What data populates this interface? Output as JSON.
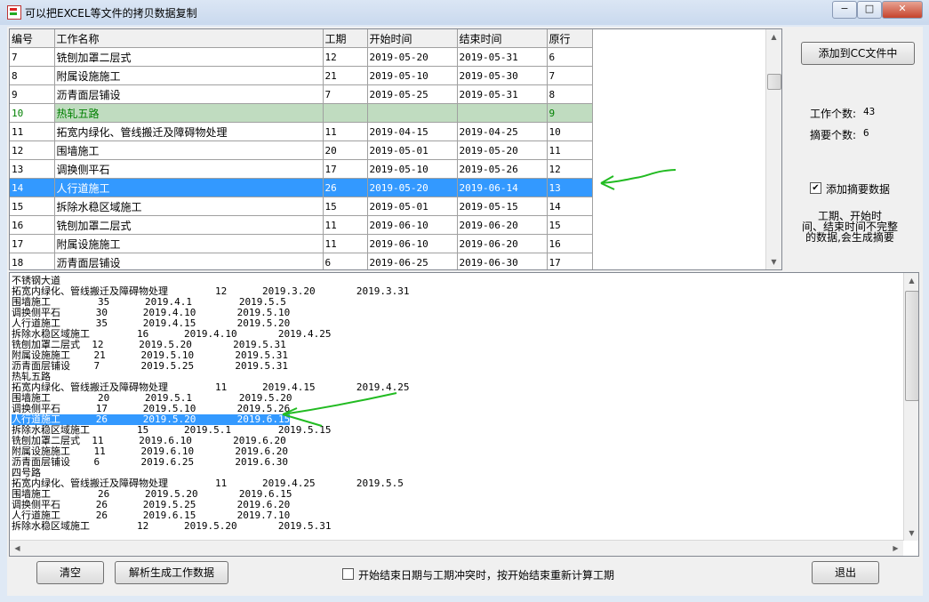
{
  "window": {
    "title": "可以把EXCEL等文件的拷贝数据复制",
    "minimize": "−",
    "maximize": "□",
    "close": "✕"
  },
  "grid": {
    "columns": [
      "编号",
      "工作名称",
      "工期",
      "开始时间",
      "结束时间",
      "原行"
    ],
    "rows": [
      [
        "7",
        "铣刨加罩二层式",
        "12",
        "2019-05-20",
        "2019-05-31",
        "6"
      ],
      [
        "8",
        "附属设施施工",
        "21",
        "2019-05-10",
        "2019-05-30",
        "7"
      ],
      [
        "9",
        "沥青面层铺设",
        "7",
        "2019-05-25",
        "2019-05-31",
        "8"
      ],
      [
        "10",
        "热轧五路",
        "",
        "",
        "",
        "9"
      ],
      [
        "11",
        "拓宽内绿化、管线搬迁及障碍物处理",
        "11",
        "2019-04-15",
        "2019-04-25",
        "10"
      ],
      [
        "12",
        "围墙施工",
        "20",
        "2019-05-01",
        "2019-05-20",
        "11"
      ],
      [
        "13",
        "调换侧平石",
        "17",
        "2019-05-10",
        "2019-05-26",
        "12"
      ],
      [
        "14",
        "人行道施工",
        "26",
        "2019-05-20",
        "2019-06-14",
        "13"
      ],
      [
        "15",
        "拆除水稳区域施工",
        "15",
        "2019-05-01",
        "2019-05-15",
        "14"
      ],
      [
        "16",
        "铣刨加罩二层式",
        "11",
        "2019-06-10",
        "2019-06-20",
        "15"
      ],
      [
        "17",
        "附属设施施工",
        "11",
        "2019-06-10",
        "2019-06-20",
        "16"
      ],
      [
        "18",
        "沥青面层铺设",
        "6",
        "2019-06-25",
        "2019-06-30",
        "17"
      ]
    ],
    "green_row_index": 3,
    "selected_row_index": 7
  },
  "side": {
    "add_button": "添加到CC文件中",
    "work_count_label": "工作个数:",
    "work_count": "43",
    "summary_count_label": "摘要个数:",
    "summary_count": "6",
    "add_summary_checked": "✔",
    "add_summary_label": "添加摘要数据",
    "note": [
      "工期、开始时",
      "间、结束时间不完整",
      "的数据,会生成摘要"
    ]
  },
  "text_lines": [
    "不锈钢大道",
    "拓宽内绿化、管线搬迁及障碍物处理        12      2019.3.20       2019.3.31",
    "围墙施工        35      2019.4.1        2019.5.5",
    "调换侧平石      30      2019.4.10       2019.5.10",
    "人行道施工      35      2019.4.15       2019.5.20",
    "拆除水稳区域施工        16      2019.4.10       2019.4.25",
    "铣刨加罩二层式  12      2019.5.20       2019.5.31",
    "附属设施施工    21      2019.5.10       2019.5.31",
    "沥青面层铺设    7       2019.5.25       2019.5.31",
    "热轧五路",
    "拓宽内绿化、管线搬迁及障碍物处理        11      2019.4.15       2019.4.25",
    "围墙施工        20      2019.5.1        2019.5.20",
    "调换侧平石      17      2019.5.10       2019.5.26",
    "人行道施工      26      2019.5.20       2019.6.15",
    "拆除水稳区域施工        15      2019.5.1        2019.5.15",
    "铣刨加罩二层式  11      2019.6.10       2019.6.20",
    "附属设施施工    11      2019.6.10       2019.6.20",
    "沥青面层铺设    6       2019.6.25       2019.6.30",
    "四号路",
    "拓宽内绿化、管线搬迁及障碍物处理        11      2019.4.25       2019.5.5",
    "围墙施工        26      2019.5.20       2019.6.15",
    "调换侧平石      26      2019.5.25       2019.6.20",
    "人行道施工      26      2019.6.15       2019.7.10",
    "拆除水稳区域施工        12      2019.5.20       2019.5.31"
  ],
  "selected_line_index": 13,
  "bottom": {
    "clear_button": "清空",
    "parse_button": "解析生成工作数据",
    "recalc_checked": "",
    "recalc_label": "开始结束日期与工期冲突时，按开始结束重新计算工期",
    "exit_button": "退出"
  },
  "colors": {
    "selection": "#3399ff",
    "green_text": "#008000",
    "green_fill": "#c0dcc0",
    "annotation_arrow": "#22bb22"
  }
}
